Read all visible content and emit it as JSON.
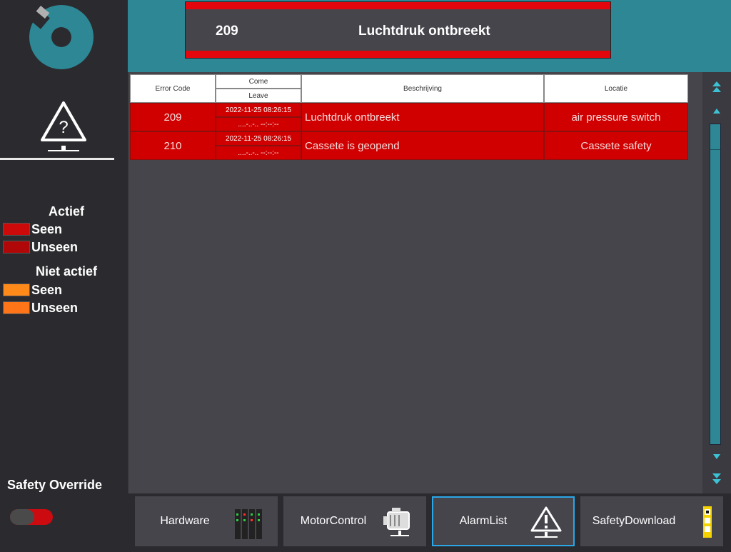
{
  "header": {
    "active_code": "209",
    "active_text": "Luchtdruk ontbreekt"
  },
  "sidebar": {
    "legend": {
      "active_title": "Actief",
      "inactive_title": "Niet actief",
      "items": [
        {
          "label": "Seen",
          "color": "#cc0a0a"
        },
        {
          "label": "Unseen",
          "color": "#b00808"
        },
        {
          "label": "Seen",
          "color": "#ff8a1a"
        },
        {
          "label": "Unseen",
          "color": "#ff7518"
        }
      ]
    },
    "safety_override": {
      "label": "Safety Override",
      "state": "off"
    }
  },
  "table": {
    "columns": {
      "code": "Error Code",
      "come": "Come",
      "leave": "Leave",
      "description": "Beschrijving",
      "location": "Locatie"
    },
    "rows": [
      {
        "code": "209",
        "come": "2022-11-25  08:26:15",
        "leave": "....-..-..    --:--:--",
        "description": "Luchtdruk ontbreekt",
        "location": "air pressure switch"
      },
      {
        "code": "210",
        "come": "2022-11-25  08:26:15",
        "leave": "....-..-..    --:--:--",
        "description": "Cassete is geopend",
        "location": "Cassete safety"
      }
    ]
  },
  "nav": {
    "buttons": [
      {
        "label": "Hardware",
        "icon": "io-modules-icon"
      },
      {
        "label": "MotorControl",
        "icon": "motor-icon"
      },
      {
        "label": "AlarmList",
        "icon": "warning-icon",
        "active": true
      },
      {
        "label": "SafetyDownload",
        "icon": "safety-download-icon"
      }
    ]
  },
  "colors": {
    "header_teal": "#2d8795",
    "alarm_red": "#d00000",
    "accent_blue": "#2aa7e6"
  }
}
